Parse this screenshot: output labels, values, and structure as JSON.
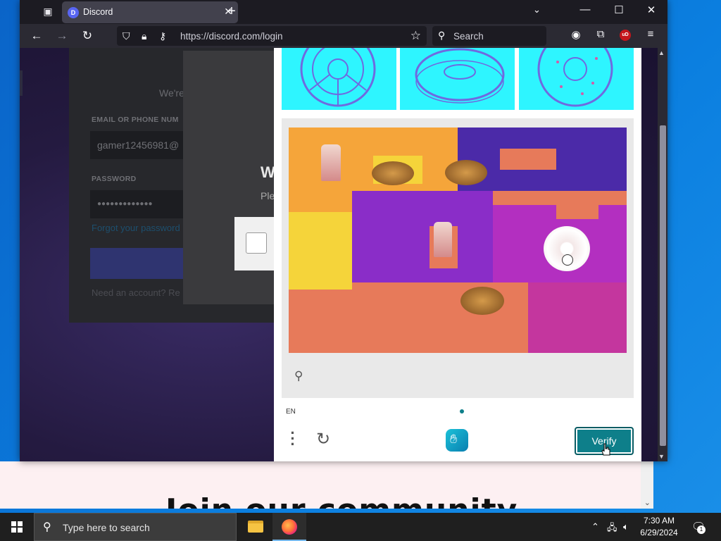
{
  "browser": {
    "tab_title": "Discord",
    "favicon_text": "D",
    "url": "https://discord.com/login",
    "search_placeholder": "Search",
    "ublock_label": "uD"
  },
  "login_page": {
    "subtitle": "We're",
    "email_label": "EMAIL OR PHONE NUM",
    "email_value": "gamer12456981@",
    "password_label": "PASSWORD",
    "password_value": "●●●●●●●●●●●●●",
    "forgot_link": "Forgot your password",
    "need_account": "Need an account? Re",
    "bg_heading": "Join our community"
  },
  "captcha_back": {
    "heading_fragment": "W",
    "text_fragment": "Ple"
  },
  "captcha": {
    "language": "EN",
    "verify_label": "Verify",
    "accent_color": "#0e7f8a"
  },
  "taskbar": {
    "search_placeholder": "Type here to search",
    "time": "7:30 AM",
    "date": "6/29/2024",
    "notification_count": "1"
  }
}
